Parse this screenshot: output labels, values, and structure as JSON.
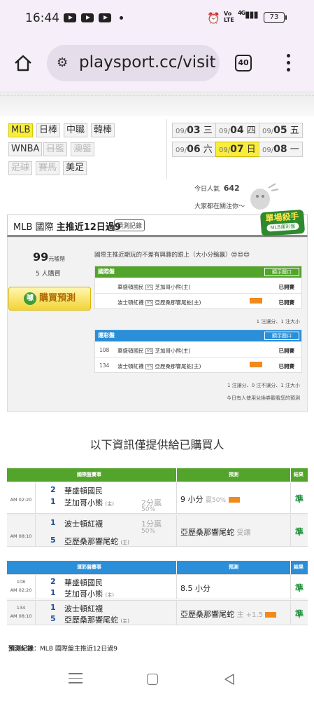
{
  "status_bar": {
    "time": "16:44",
    "volte": "Vo LTE",
    "network": "4G",
    "battery": "73"
  },
  "browser": {
    "url": "playsport.cc/visit",
    "tab_count": "40"
  },
  "leagues": [
    {
      "label": "MLB",
      "active": true,
      "enabled": true
    },
    {
      "label": "日棒",
      "active": false,
      "enabled": true
    },
    {
      "label": "中職",
      "active": false,
      "enabled": true
    },
    {
      "label": "韓棒",
      "active": false,
      "enabled": true
    },
    {
      "label": "WNBA",
      "active": false,
      "enabled": true
    },
    {
      "label": "日籃",
      "active": false,
      "enabled": false
    },
    {
      "label": "澳籃",
      "active": false,
      "enabled": false
    },
    {
      "label": "足球",
      "active": false,
      "enabled": false
    },
    {
      "label": "賽馬",
      "active": false,
      "enabled": false
    },
    {
      "label": "美足",
      "active": false,
      "enabled": true
    }
  ],
  "dates": [
    {
      "month": "09/",
      "day": "03",
      "weekday": "三",
      "active": false
    },
    {
      "month": "09/",
      "day": "04",
      "weekday": "四",
      "active": false
    },
    {
      "month": "09/",
      "day": "05",
      "weekday": "五",
      "active": false
    },
    {
      "month": "09/",
      "day": "06",
      "weekday": "六",
      "active": false
    },
    {
      "month": "09/",
      "day": "07",
      "weekday": "日",
      "active": true
    },
    {
      "month": "09/",
      "day": "08",
      "weekday": "一",
      "active": false
    }
  ],
  "popularity": {
    "label": "今日人氣",
    "value": "642",
    "watching": "大家都在關注你～"
  },
  "title": {
    "prefix": "MLB 國際 ",
    "bold": "主推近12日過9",
    "record_button": "預測記錄"
  },
  "badge": {
    "line1": "單場殺手",
    "line2": "MLB運彩盤"
  },
  "purchase": {
    "price": "99",
    "price_unit": "元噱幣",
    "buyers": "5 人購買",
    "buy_button": "購買預測",
    "coin_glyph": "噱",
    "description": "國際主推近期玩的不差有興趣的跟上（大小分輸贏）😍😍😍"
  },
  "intl_table": {
    "title": "國際盤",
    "show_button": "顯示題口",
    "rows": [
      {
        "number": "",
        "away": "華盛頓國民",
        "vs": "VS",
        "home": "芝加哥小熊(主)",
        "flag": false,
        "status": "已開賽"
      },
      {
        "number": "",
        "away": "波士頓紅襪",
        "vs": "VS",
        "home": "亞歷桑那響尾蛇(主)",
        "flag": true,
        "status": "已開賽"
      }
    ],
    "meta": "1 注讓分、1 注大小"
  },
  "lottery_table": {
    "title": "運彩盤",
    "show_button": "顯示題口",
    "rows": [
      {
        "number": "108",
        "away": "華盛頓國民",
        "vs": "VS",
        "home": "芝加哥小熊(主)",
        "flag": false,
        "status": "已開賽"
      },
      {
        "number": "134",
        "away": "波士頓紅襪",
        "vs": "VS",
        "home": "亞歷桑那響尾蛇(主)",
        "flag": true,
        "status": "已開賽"
      }
    ],
    "meta": "1 注讓分、0 注不讓分、1 注大小",
    "meta2": "今日有人使用兌換券觀看您的預測"
  },
  "buyers_note": "以下資訊僅提供給已購買人",
  "results_intl": {
    "headers": {
      "game": "國際盤賽事",
      "pick": "預測",
      "result": "結果"
    },
    "rows": [
      {
        "time_ampm": "AM 02:20",
        "num": "",
        "away_score": "2",
        "away": "華盛頓國民",
        "home_score": "1",
        "home": "芝加哥小熊",
        "home_mark": "(主)",
        "line": "2分贏",
        "line_pct": "50%",
        "pick": "9 小分",
        "pick_extra": "贏50%",
        "result": "準"
      },
      {
        "time_ampm": "AM 08:10",
        "num": "",
        "away_score": "1",
        "away": "波士頓紅襪",
        "home_score": "5",
        "home": "亞歷桑那響尾蛇",
        "home_mark": "(主)",
        "line": "1分贏",
        "line_pct": "50%",
        "pick": "亞歷桑那響尾蛇",
        "pick_extra": "受讓",
        "result": "準"
      }
    ]
  },
  "results_lottery": {
    "headers": {
      "game": "運彩盤賽事",
      "pick": "預測",
      "result": "結果"
    },
    "rows": [
      {
        "time_ampm": "AM 02:20",
        "num": "108",
        "away_score": "2",
        "away": "華盛頓國民",
        "home_score": "1",
        "home": "芝加哥小熊",
        "home_mark": "(主)",
        "pick": "8.5 小分",
        "pick_extra": "",
        "result": "準"
      },
      {
        "time_ampm": "AM 08:10",
        "num": "134",
        "away_score": "1",
        "away": "波士頓紅襪",
        "home_score": "5",
        "home": "亞歷桑那響尾蛇",
        "home_mark": "(主)",
        "pick": "亞歷桑那響尾蛇",
        "pick_extra": "主 +1.5",
        "result": "準"
      }
    ]
  },
  "footer": {
    "label": "預測紀錄",
    "text": "：MLB 國際盤主推近12日過9"
  },
  "colors": {
    "green": "#52a42b",
    "blue": "#2a8fd8",
    "yellow": "#f8ec3c",
    "orange": "#f08a1c"
  }
}
